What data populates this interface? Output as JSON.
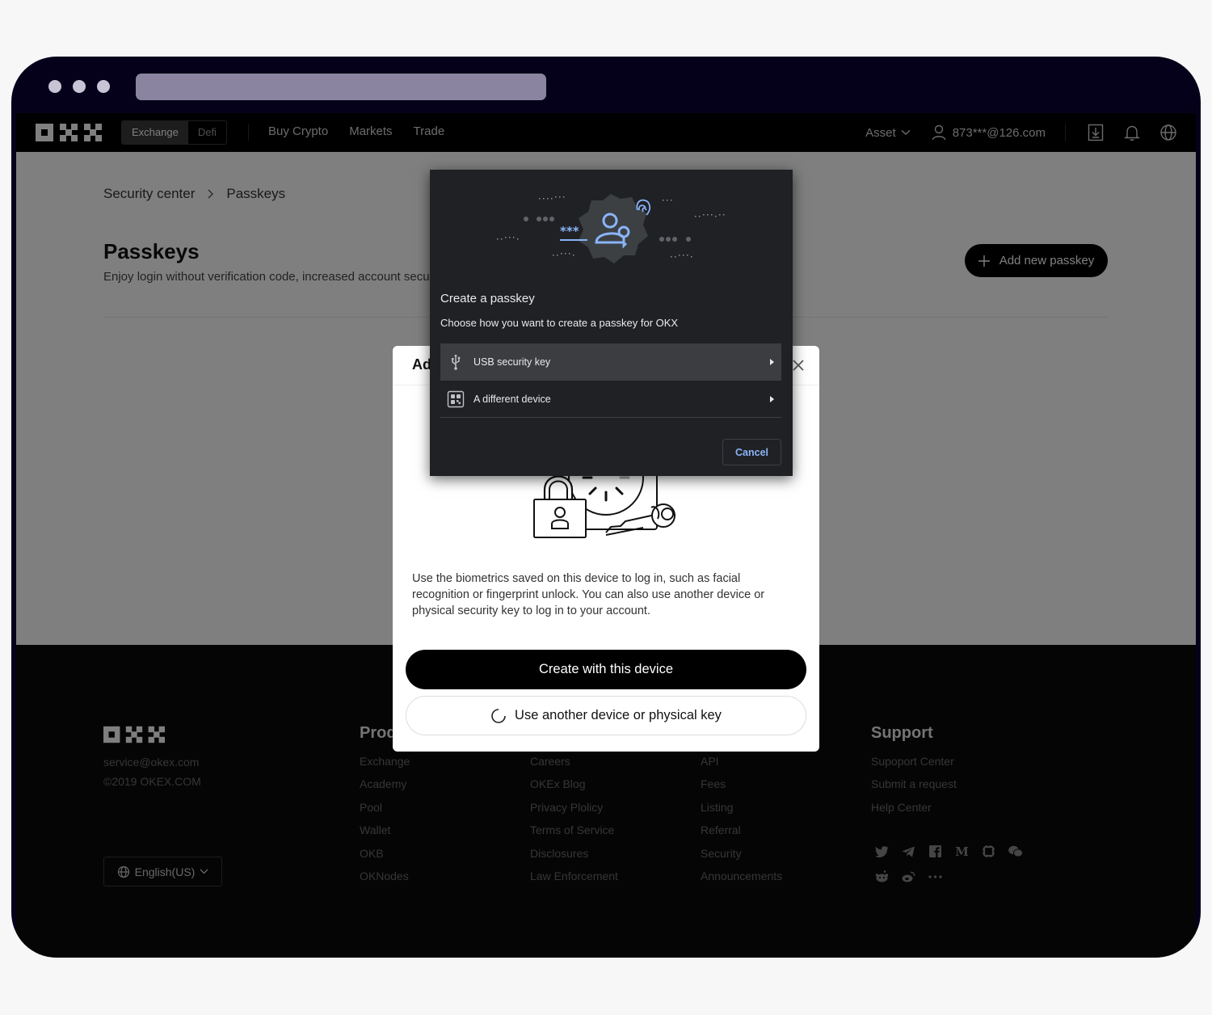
{
  "nav": {
    "switch": [
      "Exchange",
      "Defi"
    ],
    "links": [
      "Buy Crypto",
      "Markets",
      "Trade"
    ],
    "asset": "Asset",
    "user": "873***@126.com"
  },
  "main": {
    "breadcrumb": [
      "Security center",
      "Passkeys"
    ],
    "title": "Passkeys",
    "subtitle": "Enjoy login without verification code, increased account security",
    "add_button": "Add new passkey"
  },
  "footer": {
    "email": "service@okex.com",
    "copyright": "©2019 OKEX.COM",
    "columns": [
      {
        "title": "Products",
        "items": [
          "Exchange",
          "Academy",
          "Pool",
          "Wallet",
          "OKB",
          "OKNodes"
        ]
      },
      {
        "title": "",
        "items": [
          "Careers",
          "OKEx Blog",
          "Privacy Plolicy",
          "Terms of Service",
          "Disclosures",
          "Law Enforcement"
        ]
      },
      {
        "title": "",
        "items": [
          "API",
          "Fees",
          "Listing",
          "Referral",
          "Security",
          "Announcements"
        ]
      },
      {
        "title": "Support",
        "items": [
          "Supoport Center",
          "Submit a request",
          "Help Center"
        ]
      }
    ],
    "language": "English(US)",
    "socials": [
      "twitter-icon",
      "telegram-icon",
      "facebook-icon",
      "medium-icon",
      "coinmarketcap-icon",
      "wechat-icon",
      "reddit-icon",
      "weibo-icon",
      "more-icon"
    ]
  },
  "modal": {
    "title": "Add passkey",
    "description": "Use the biometrics saved on this device to log in, such as facial recognition or fingerprint unlock. You can also use another device or physical security key to log in to your account.",
    "primary": "Create with this device",
    "secondary": "Use another device or physical key"
  },
  "passkey_dialog": {
    "title": "Create a passkey",
    "subtitle": "Choose how you want to create a passkey for OKX",
    "options": [
      "USB security key",
      "A different device"
    ],
    "cancel": "Cancel",
    "hero_password_mask": "***",
    "accent_color": "#8ab4f8"
  }
}
